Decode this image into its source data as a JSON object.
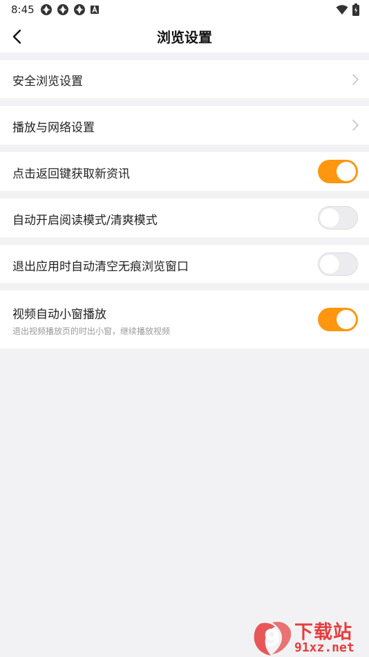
{
  "status_bar": {
    "time": "8:45",
    "left_icons": [
      "app-notification-icon",
      "app-notification-icon",
      "app-notification-icon",
      "a-badge-icon"
    ],
    "right_icons": [
      "wifi-icon",
      "battery-icon"
    ]
  },
  "nav": {
    "title": "浏览设置",
    "back_icon": "chevron-left-icon"
  },
  "settings": {
    "safe_browsing": {
      "label": "安全浏览设置"
    },
    "play_network": {
      "label": "播放与网络设置"
    },
    "back_key_news": {
      "label": "点击返回键获取新资讯",
      "enabled": true
    },
    "auto_reading_mode": {
      "label": "自动开启阅读模式/清爽模式",
      "enabled": false
    },
    "clear_incognito": {
      "label": "退出应用时自动清空无痕浏览窗口",
      "enabled": false
    },
    "video_mini_window": {
      "label": "视频自动小窗播放",
      "description": "退出视频播放页的时出小窗，继续播放视频",
      "enabled": true
    }
  },
  "watermark": {
    "logo_text": "9",
    "title": "下载站",
    "domain": "91xz.net"
  },
  "colors": {
    "accent": "#ff9610",
    "background": "#f2f2f4",
    "watermark": "#e63c3c"
  }
}
